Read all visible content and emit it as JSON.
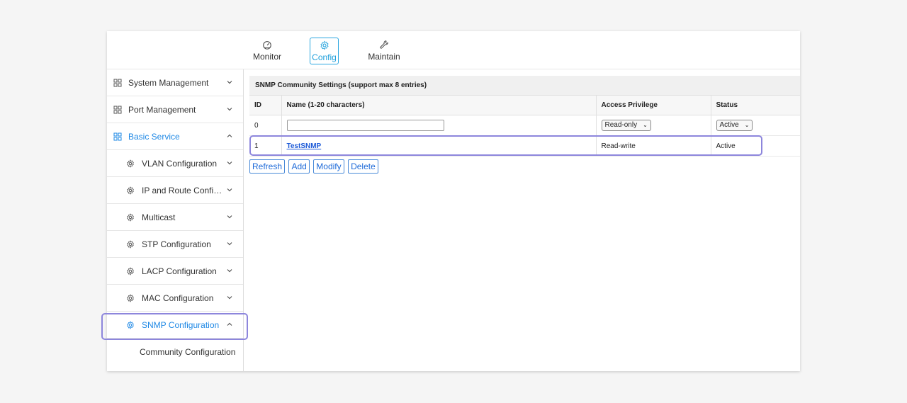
{
  "topnav": {
    "tabs": [
      {
        "label": "Monitor",
        "icon": "gauge-icon"
      },
      {
        "label": "Config",
        "icon": "gear-icon",
        "active": true
      },
      {
        "label": "Maintain",
        "icon": "wrench-icon"
      }
    ]
  },
  "sidebar": {
    "items": [
      {
        "label": "System Management",
        "icon": "grid-icon",
        "expanded": false
      },
      {
        "label": "Port Management",
        "icon": "grid-icon",
        "expanded": false
      },
      {
        "label": "Basic Service",
        "icon": "grid-icon",
        "expanded": true,
        "active": true
      },
      {
        "label": "VLAN Configuration",
        "icon": "gear-icon"
      },
      {
        "label": "IP and Route Configuration",
        "icon": "gear-icon"
      },
      {
        "label": "Multicast",
        "icon": "gear-icon"
      },
      {
        "label": "STP Configuration",
        "icon": "gear-icon"
      },
      {
        "label": "LACP Configuration",
        "icon": "gear-icon"
      },
      {
        "label": "MAC Configuration",
        "icon": "gear-icon"
      },
      {
        "label": "SNMP Configuration",
        "icon": "gear-icon",
        "expanded": true,
        "active": true
      },
      {
        "label": "Community Configuration"
      }
    ]
  },
  "table": {
    "title": "SNMP Community Settings (support max 8 entries)",
    "headers": [
      "ID",
      "Name (1-20 characters)",
      "Access Privilege",
      "Status"
    ],
    "new_row": {
      "id": "0",
      "name_value": "",
      "access": "Read-only",
      "status": "Active"
    },
    "rows": [
      {
        "id": "1",
        "name": "TestSNMP",
        "access": "Read-write",
        "status": "Active"
      }
    ]
  },
  "buttons": {
    "refresh": "Refresh",
    "add": "Add",
    "modify": "Modify",
    "delete": "Delete"
  },
  "colors": {
    "accent": "#1e88e5",
    "highlight": "#8d86dc",
    "link": "#1e5bd8"
  }
}
